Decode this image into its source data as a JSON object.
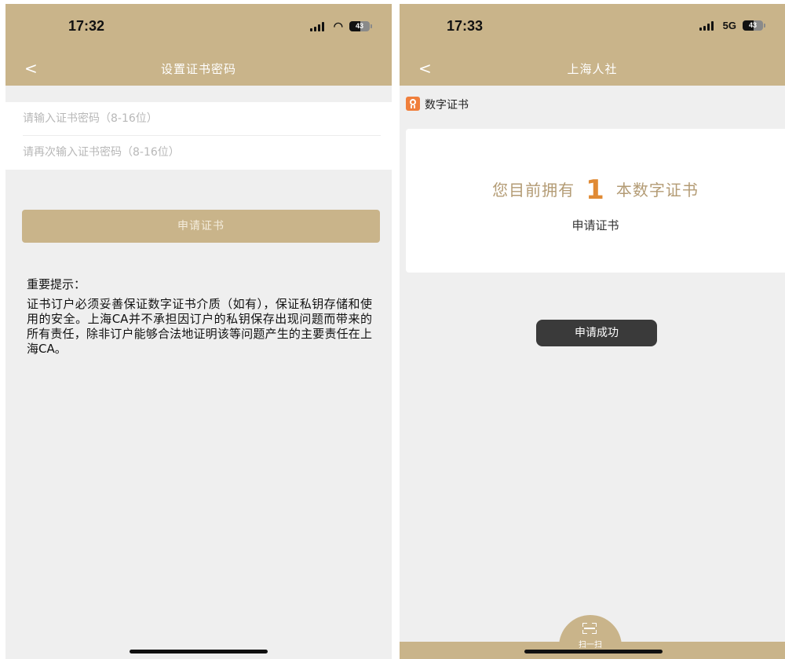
{
  "left_screen": {
    "status": {
      "time": "17:32",
      "battery": "43"
    },
    "nav": {
      "back": "<",
      "title": "设置证书密码"
    },
    "form": {
      "password_placeholder": "请输入证书密码（8-16位）",
      "confirm_placeholder": "请再次输入证书密码（8-16位）"
    },
    "apply_button": "申请证书",
    "notice": {
      "title": "重要提示：",
      "body": "证书订户必须妥善保证数字证书介质（如有），保证私钥存储和使用的安全。上海CA并不承担因订户的私钥保存出现问题而带来的所有责任，除非订户能够合法地证明该等问题产生的主要责任在上海CA。"
    }
  },
  "right_screen": {
    "status": {
      "time": "17:33",
      "network": "5G",
      "battery": "43"
    },
    "nav": {
      "back": "<",
      "title": "上海人社"
    },
    "section": {
      "label": "数字证书"
    },
    "card": {
      "prefix": "您目前拥有",
      "count": "1",
      "suffix": "本数字证书",
      "apply_link": "申请证书"
    },
    "toast": "申请成功",
    "scan": {
      "label": "扫一扫"
    }
  },
  "colors": {
    "primary": "#c9b48a",
    "accent": "#e08a34",
    "background": "#efefef",
    "toast": "#3a3a3a",
    "icon": "#f07f3c"
  }
}
